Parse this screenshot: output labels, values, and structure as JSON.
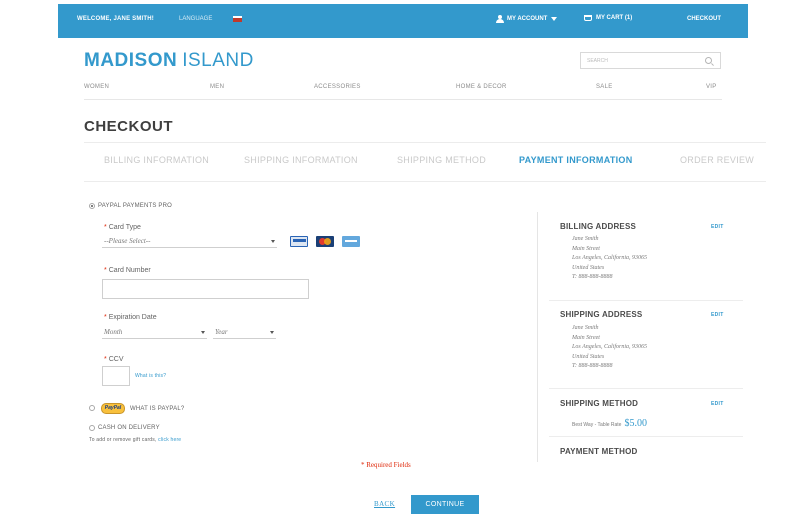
{
  "topbar": {
    "welcome": "WELCOME, JANE SMITH!",
    "language_label": "LANGUAGE",
    "account_label": "MY ACCOUNT",
    "cart_label": "MY CART (1)",
    "checkout_label": "CHECKOUT"
  },
  "header": {
    "logo_bold": "MADISON",
    "logo_light": "ISLAND",
    "search_placeholder": "SEARCH"
  },
  "nav": [
    "WOMEN",
    "MEN",
    "ACCESSORIES",
    "HOME & DECOR",
    "SALE",
    "VIP"
  ],
  "checkout": {
    "title": "CHECKOUT",
    "steps": [
      {
        "label": "BILLING INFORMATION",
        "active": false
      },
      {
        "label": "SHIPPING INFORMATION",
        "active": false
      },
      {
        "label": "SHIPPING METHOD",
        "active": false
      },
      {
        "label": "PAYMENT INFORMATION",
        "active": true
      },
      {
        "label": "ORDER REVIEW",
        "active": false
      }
    ]
  },
  "payment": {
    "option_paypal_pro": "PAYPAL PAYMENTS PRO",
    "card_type_label": "Card Type",
    "card_type_value": "--Please Select--",
    "card_number_label": "Card Number",
    "card_number_value": "",
    "expiration_label": "Expiration Date",
    "month_value": "Month",
    "year_value": "Year",
    "ccv_label": "CCV",
    "ccv_value": "",
    "ccv_help": "What is this?",
    "paypal_badge": "PayPal",
    "what_is_paypal": "WHAT IS PAYPAL?",
    "option_cod": "CASH ON DELIVERY",
    "gift_card_text": "To add or remove gift cards,",
    "gift_card_link": "click here",
    "required_fields": "* Required Fields",
    "back_label": "BACK",
    "continue_label": "CONTINUE"
  },
  "progress": {
    "billing_heading": "BILLING ADDRESS",
    "billing_edit": "EDIT",
    "billing_lines": [
      "Jane Smith",
      "Main Street",
      "Los Angeles, California, 93065",
      "United States",
      "T: 888-888-8888"
    ],
    "shipping_heading": "SHIPPING ADDRESS",
    "shipping_edit": "EDIT",
    "shipping_lines": [
      "Jane Smith",
      "Main Street",
      "Los Angeles, California, 93065",
      "United States",
      "T: 888-888-8888"
    ],
    "method_heading": "SHIPPING METHOD",
    "method_edit": "EDIT",
    "method_text": "Best Way - Table Rate",
    "method_price": "$5.00",
    "payment_heading": "PAYMENT METHOD"
  },
  "colors": {
    "accent": "#3399cc",
    "required": "#df280a"
  }
}
